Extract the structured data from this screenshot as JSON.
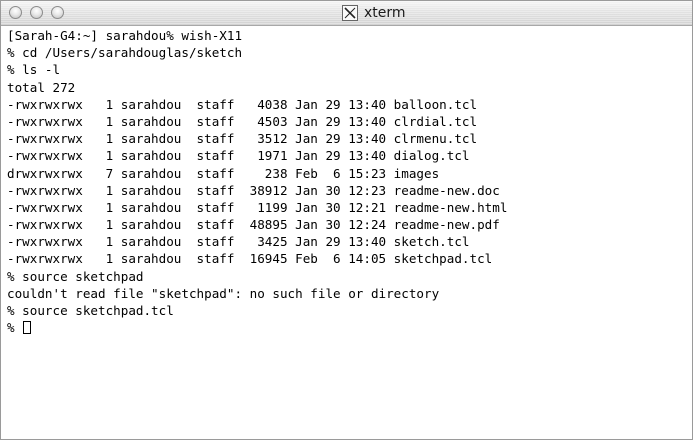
{
  "window": {
    "title": "xterm",
    "icon": "x-window-icon"
  },
  "terminal": {
    "lines": [
      "[Sarah-G4:~] sarahdou% wish-X11",
      "% cd /Users/sarahdouglas/sketch",
      "% ls -l",
      "total 272",
      "-rwxrwxrwx   1 sarahdou  staff   4038 Jan 29 13:40 balloon.tcl",
      "-rwxrwxrwx   1 sarahdou  staff   4503 Jan 29 13:40 clrdial.tcl",
      "-rwxrwxrwx   1 sarahdou  staff   3512 Jan 29 13:40 clrmenu.tcl",
      "-rwxrwxrwx   1 sarahdou  staff   1971 Jan 29 13:40 dialog.tcl",
      "drwxrwxrwx   7 sarahdou  staff    238 Feb  6 15:23 images",
      "-rwxrwxrwx   1 sarahdou  staff  38912 Jan 30 12:23 readme-new.doc",
      "-rwxrwxrwx   1 sarahdou  staff   1199 Jan 30 12:21 readme-new.html",
      "-rwxrwxrwx   1 sarahdou  staff  48895 Jan 30 12:24 readme-new.pdf",
      "-rwxrwxrwx   1 sarahdou  staff   3425 Jan 29 13:40 sketch.tcl",
      "-rwxrwxrwx   1 sarahdou  staff  16945 Feb  6 14:05 sketchpad.tcl",
      "% source sketchpad",
      "couldn't read file \"sketchpad\": no such file or directory",
      "% source sketchpad.tcl"
    ],
    "prompt": "% "
  }
}
